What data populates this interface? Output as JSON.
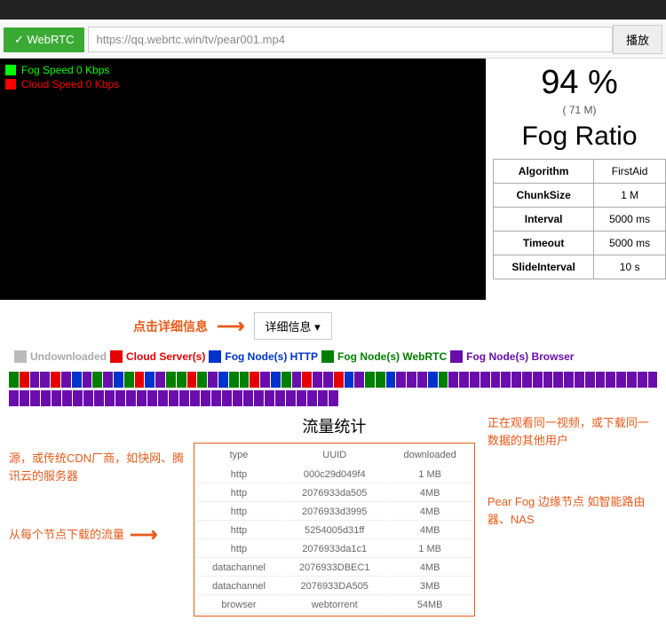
{
  "topbar": {
    "webrtc": "✓ WebRTC",
    "url": "https://qq.webrtc.win/tv/pear001.mp4",
    "play": "播放"
  },
  "speed": {
    "fog": "Fog Speed 0 Kbps",
    "cloud": "Cloud Speed 0 Kbps"
  },
  "stats": {
    "percent": "94 %",
    "sub": "( 71 M)",
    "title": "Fog Ratio"
  },
  "config": [
    {
      "k": "Algorithm",
      "v": "FirstAid"
    },
    {
      "k": "ChunkSize",
      "v": "1 M"
    },
    {
      "k": "Interval",
      "v": "5000 ms"
    },
    {
      "k": "Timeout",
      "v": "5000 ms"
    },
    {
      "k": "SlideInterval",
      "v": "10 s"
    }
  ],
  "detail_hint": "点击详细信息",
  "detail_btn": "详细信息 ▾",
  "legends": [
    {
      "label": "Undownloaded",
      "color": "gray"
    },
    {
      "label": "Cloud Server(s)",
      "color": "red"
    },
    {
      "label": "Fog Node(s) HTTP",
      "color": "blue"
    },
    {
      "label": "Fog Node(s) WebRTC",
      "color": "green"
    },
    {
      "label": "Fog Node(s) Browser",
      "color": "purple"
    }
  ],
  "chunks_row1": [
    "green",
    "red",
    "purple",
    "purple",
    "red",
    "purple",
    "blue",
    "purple",
    "green",
    "purple",
    "blue",
    "green",
    "red",
    "blue",
    "purple",
    "green",
    "green",
    "red",
    "green",
    "purple",
    "blue",
    "green",
    "green",
    "red",
    "purple",
    "blue",
    "green",
    "purple",
    "red",
    "purple",
    "purple",
    "red",
    "blue",
    "purple",
    "green",
    "green",
    "blue",
    "purple",
    "purple",
    "purple",
    "blue",
    "green",
    "purple",
    "purple",
    "purple",
    "purple",
    "purple",
    "purple",
    "purple",
    "purple",
    "purple",
    "purple",
    "purple",
    "purple",
    "purple",
    "purple",
    "purple",
    "purple",
    "purple",
    "purple",
    "purple",
    "purple"
  ],
  "chunks_row2": [
    "purple",
    "purple",
    "purple",
    "purple",
    "purple",
    "purple",
    "purple",
    "purple",
    "purple",
    "purple",
    "purple",
    "purple",
    "purple",
    "purple",
    "purple",
    "purple",
    "purple",
    "purple",
    "purple",
    "purple",
    "purple",
    "purple",
    "purple",
    "purple",
    "purple",
    "purple",
    "purple",
    "purple",
    "purple",
    "purple",
    "purple"
  ],
  "traffic_title": "流量统计",
  "traffic_headers": [
    "type",
    "UUID",
    "downloaded"
  ],
  "traffic_rows": [
    {
      "type": "http",
      "uuid": "000c29d049f4",
      "dl": "1 MB"
    },
    {
      "type": "http",
      "uuid": "2076933da505",
      "dl": "4MB"
    },
    {
      "type": "http",
      "uuid": "2076933d3995",
      "dl": "4MB"
    },
    {
      "type": "http",
      "uuid": "5254005d31ff",
      "dl": "4MB"
    },
    {
      "type": "http",
      "uuid": "2076933da1c1",
      "dl": "1 MB"
    },
    {
      "type": "datachannel",
      "uuid": "2076933DBEC1",
      "dl": "4MB"
    },
    {
      "type": "datachannel",
      "uuid": "2076933DA505",
      "dl": "3MB"
    },
    {
      "type": "browser",
      "uuid": "webtorrent",
      "dl": "54MB"
    }
  ],
  "notes": {
    "cloud": "源，或传统CDN厂商，如快网、腾讯云的服务器",
    "per_node": "从每个节点下载的流量",
    "browser": "正在观看同一视频，或下载同一数据的其他用户",
    "edge": "Pear Fog 边缘节点 如智能路由器、NAS"
  }
}
